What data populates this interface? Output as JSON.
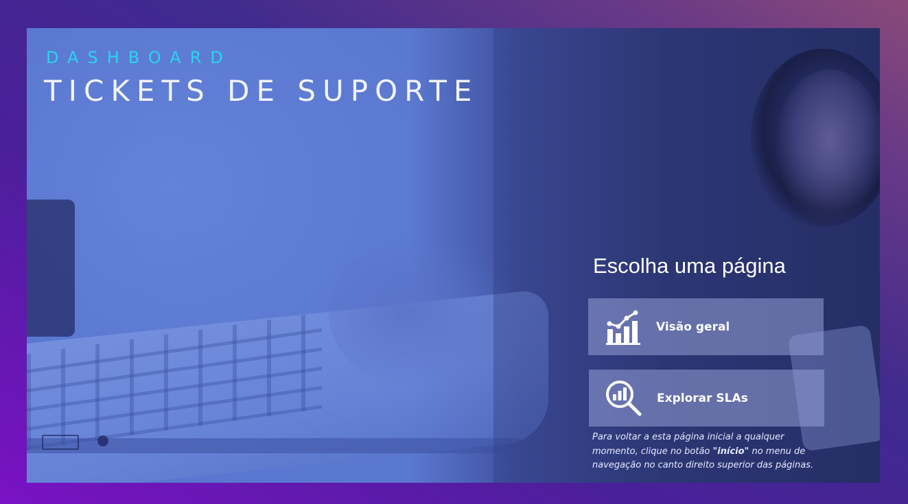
{
  "header": {
    "subtitle": "DASHBOARD",
    "title": "TICKETS DE SUPORTE"
  },
  "navigation": {
    "heading": "Escolha uma página",
    "buttons": [
      {
        "label": "Visão geral",
        "icon": "chart-growth-icon"
      },
      {
        "label": "Explorar SLAs",
        "icon": "magnifier-chart-icon"
      }
    ]
  },
  "note": {
    "part1": "Para voltar a esta página inicial a qualquer momento, clique no botão ",
    "emphasis": "\"início\"",
    "part2": " no menu de navegação no canto direito superior das páginas."
  },
  "colors": {
    "accent": "#2ad4f0",
    "title": "#f2f4ff",
    "button_bg": "rgba(150,160,215,0.55)"
  }
}
